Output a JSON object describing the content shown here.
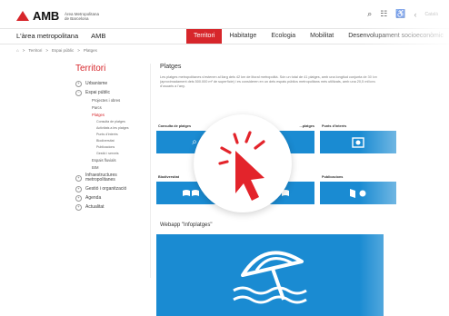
{
  "header": {
    "logo_text": "AMB",
    "logo_sub": "Àrea Metropolitana de Barcelona",
    "lang": "Català",
    "icons": [
      "search-icon",
      "grid-icon",
      "accessibility-icon",
      "share-icon"
    ]
  },
  "nav": {
    "left": [
      "L'àrea metropolitana",
      "AMB"
    ],
    "right": [
      "Territori",
      "Habitatge",
      "Ecologia",
      "Mobilitat",
      "Desenvolupament socioeconòmic"
    ],
    "active_index": 0
  },
  "breadcrumb": [
    "Territori",
    "Espai públic",
    "Platges"
  ],
  "sidebar": {
    "title": "Territori",
    "items": [
      {
        "label": "Urbanisme"
      },
      {
        "label": "Espai públic"
      }
    ],
    "subitems": [
      "Projectes i obres",
      "Parcs",
      "Platges"
    ],
    "platges_children": [
      "Consulta de platges",
      "Activitats a les platges",
      "Punts d'interès",
      "Biodiversitat",
      "Publicacions",
      "Gestió i serveis"
    ],
    "subitems_after": [
      "Espais fluvials",
      "BIM"
    ],
    "items_after": [
      {
        "label": "Infraestructures metropolitanes"
      },
      {
        "label": "Gestió i organització"
      },
      {
        "label": "Agenda"
      },
      {
        "label": "Actualitat"
      }
    ]
  },
  "main": {
    "title": "Platges",
    "description": "Les platges metropolitanes s'estenen al llarg dels 42 km de litoral metropolità. Són un total de 41 platges, amb una longitud conjunta de 30 km (aproximadament dels 500.000 m² de superfície) i es consideren en un dels espais públics metropolitans més utilitzats, amb una 20,5 milions d'usuaris a l'any.",
    "cards": [
      {
        "label": "Consulta de platges",
        "icon": "search-icon"
      },
      {
        "label": "...platges",
        "icon": "ball-icon"
      },
      {
        "label": "Punts d'interès",
        "icon": "map-pin-icon"
      },
      {
        "label": "Biodiversitat",
        "icon": "fish-icon"
      },
      {
        "label": "",
        "icon": "waves-icon"
      },
      {
        "label": "Publicacions",
        "icon": "book-icon"
      }
    ],
    "webapp_label": "Webapp \"Infoplatges\""
  },
  "colors": {
    "accent": "#d7262b",
    "card_blue": "#1a8bd2"
  }
}
